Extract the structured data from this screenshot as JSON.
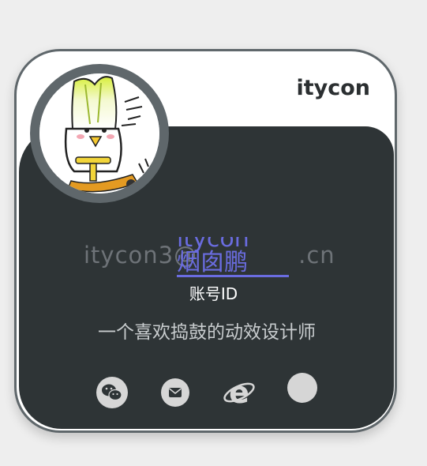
{
  "profile": {
    "username": "itycon",
    "email_text": "itycon3@",
    "email_suffix": ".cn",
    "link_line1": "itycon",
    "link_line2": "烟囱鹏",
    "id_label": "账号ID",
    "bio": "一个喜欢捣鼓的动效设计师"
  },
  "social": {
    "wechat": "wechat-icon",
    "mail": "mail-icon",
    "browser": "ie-browser-icon",
    "extra": "placeholder-circle-icon"
  },
  "colors": {
    "background": "#eeeeee",
    "card_border": "#5f676b",
    "dark_panel": "#2e3436",
    "link_accent": "#6a6ce0"
  }
}
